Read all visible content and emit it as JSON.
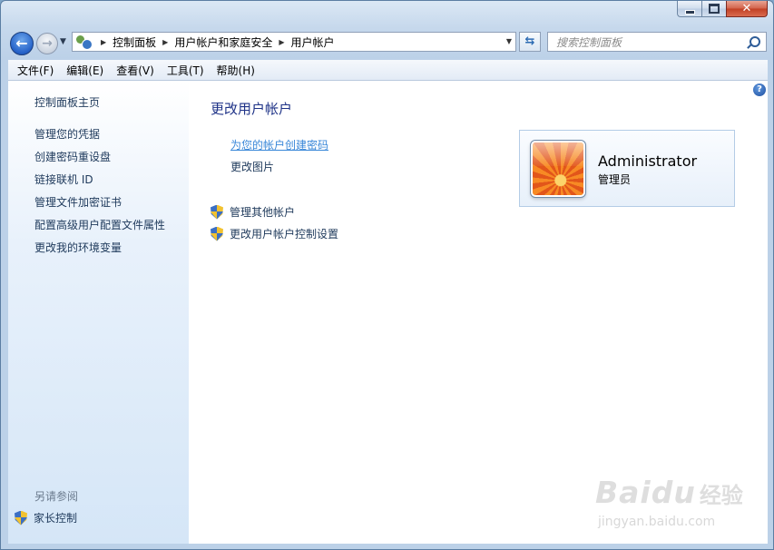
{
  "window": {
    "caption": {
      "minimize": "",
      "maximize": "",
      "close": "✕"
    }
  },
  "nav": {
    "breadcrumbs": [
      "控制面板",
      "用户帐户和家庭安全",
      "用户帐户"
    ],
    "search_placeholder": "搜索控制面板"
  },
  "menu": [
    "文件(F)",
    "编辑(E)",
    "查看(V)",
    "工具(T)",
    "帮助(H)"
  ],
  "sidebar": {
    "home_link": "控制面板主页",
    "tasks": [
      "管理您的凭据",
      "创建密码重设盘",
      "链接联机 ID",
      "管理文件加密证书",
      "配置高级用户配置文件属性",
      "更改我的环境变量"
    ],
    "see_also_title": "另请参阅",
    "see_also_links": [
      "家长控制"
    ]
  },
  "main": {
    "title": "更改用户帐户",
    "links": [
      "为您的帐户创建密码",
      "更改图片"
    ],
    "shield_links": [
      "管理其他帐户",
      "更改用户帐户控制设置"
    ],
    "account": {
      "name": "Administrator",
      "role": "管理员"
    },
    "help": "?"
  },
  "watermark": {
    "brand": "Baidu",
    "cn": "经验",
    "url": "jingyan.baidu.com"
  },
  "colors": {
    "link": "#1e395b",
    "title": "#1e3287",
    "hover_link": "#3987d8",
    "pane_bg": "#d5e6f7"
  },
  "icons": [
    "back-arrow-icon",
    "forward-arrow-icon",
    "user-accounts-icon",
    "refresh-icon",
    "search-icon",
    "uac-shield-icon",
    "help-icon"
  ]
}
